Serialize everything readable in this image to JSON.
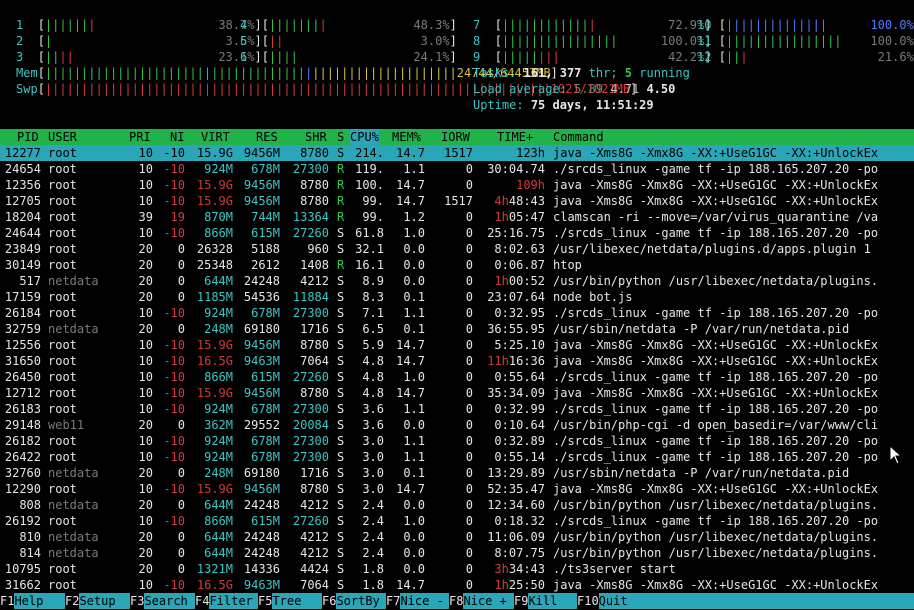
{
  "meters": {
    "cpus": [
      {
        "id": "1",
        "bar_green": "||||||",
        "bar_red": "|",
        "pct": "38.7%"
      },
      {
        "id": "2",
        "bar_green": "|",
        "bar_red": "",
        "pct": "3.6%"
      },
      {
        "id": "3",
        "bar_green": "||",
        "bar_red": "||",
        "pct": "23.1%"
      },
      {
        "id": "4",
        "bar_green": "|||||||",
        "bar_red": "|",
        "pct": "48.3%"
      },
      {
        "id": "5",
        "bar_green": "",
        "bar_red": "||",
        "pct": "3.0%"
      },
      {
        "id": "6",
        "bar_green": "||||",
        "bar_red": "",
        "pct": "24.1%"
      },
      {
        "id": "7",
        "bar_green": "||||||||||||",
        "bar_red": "|",
        "pct": "72.9%"
      },
      {
        "id": "8",
        "bar_green": "||||||||||||||||",
        "bar_red": "",
        "pct": "100.0%"
      },
      {
        "id": "9",
        "bar_green": "|||||",
        "bar_red": "|||",
        "pct": "42.2%"
      },
      {
        "id": "10",
        "bar_green": "",
        "bar_red": "",
        "pct": "100.0%",
        "bar_blue": "||||||||||||||"
      },
      {
        "id": "11",
        "bar_green": "||||||||||||||||",
        "bar_red": "",
        "pct": "100.0%"
      },
      {
        "id": "12",
        "bar_green": "||",
        "bar_red": "|",
        "pct": "21.6%"
      }
    ],
    "mem": {
      "label": "Mem",
      "value": "24744/64453MB"
    },
    "swp": {
      "label": "Swp",
      "value": "1021/1021MB"
    }
  },
  "summary": {
    "tasks_label": "Tasks:",
    "tasks_value": "161,",
    "threads_value": "377",
    "threads_label": "thr;",
    "running_value": "5",
    "running_label": "running",
    "load_label": "Load average:",
    "load_1": "5.89",
    "load_5": "4.71",
    "load_15": "4.50",
    "uptime_label": "Uptime:",
    "uptime_value": "75 days, 11:51:29"
  },
  "columns": [
    "PID",
    "USER",
    "PRI",
    "NI",
    "VIRT",
    "RES",
    "SHR",
    "S",
    "CPU%",
    "MEM%",
    "IORW",
    "TIME+",
    "Command"
  ],
  "processes": [
    {
      "pid": "12277",
      "user": "root",
      "pri": "10",
      "ni": "-10",
      "virt": "15.9G",
      "res": "9456M",
      "shr": "8780",
      "s": "S",
      "cpu": "214.",
      "mem": "14.7",
      "iorw": "1517",
      "time": "123h",
      "cmd": "java -Xms8G -Xmx8G -XX:+UseG1GC -XX:+UnlockEx"
    },
    {
      "pid": "24654",
      "user": "root",
      "pri": "10",
      "ni": "-10",
      "virt": "924M",
      "res": "678M",
      "shr": "27300",
      "s": "R",
      "cpu": "119.",
      "mem": "1.1",
      "iorw": "0",
      "time": "30:04.74",
      "cmd": "./srcds_linux -game tf -ip 188.165.207.20 -po"
    },
    {
      "pid": "12356",
      "user": "root",
      "pri": "10",
      "ni": "-10",
      "virt": "15.9G",
      "res": "9456M",
      "shr": "8780",
      "s": "R",
      "cpu": "100.",
      "mem": "14.7",
      "iorw": "0",
      "time": "109h",
      "cmd": "java -Xms8G -Xmx8G -XX:+UseG1GC -XX:+UnlockEx"
    },
    {
      "pid": "12705",
      "user": "root",
      "pri": "10",
      "ni": "-10",
      "virt": "15.9G",
      "res": "9456M",
      "shr": "8780",
      "s": "R",
      "cpu": "99.",
      "mem": "14.7",
      "iorw": "1517",
      "time": "4h48:43",
      "cmd": "java -Xms8G -Xmx8G -XX:+UseG1GC -XX:+UnlockEx"
    },
    {
      "pid": "18204",
      "user": "root",
      "pri": "39",
      "ni": "19",
      "virt": "870M",
      "res": "744M",
      "shr": "13364",
      "s": "R",
      "cpu": "99.",
      "mem": "1.2",
      "iorw": "0",
      "time": "1h05:47",
      "cmd": "clamscan -ri --move=/var/virus_quarantine /va"
    },
    {
      "pid": "24644",
      "user": "root",
      "pri": "10",
      "ni": "-10",
      "virt": "866M",
      "res": "615M",
      "shr": "27260",
      "s": "S",
      "cpu": "61.8",
      "mem": "1.0",
      "iorw": "0",
      "time": "25:16.75",
      "cmd": "./srcds_linux -game tf -ip 188.165.207.20 -po"
    },
    {
      "pid": "23849",
      "user": "root",
      "pri": "20",
      "ni": "0",
      "virt": "26328",
      "res": "5188",
      "shr": "960",
      "s": "S",
      "cpu": "32.1",
      "mem": "0.0",
      "iorw": "0",
      "time": "8:02.63",
      "cmd": "/usr/libexec/netdata/plugins.d/apps.plugin 1"
    },
    {
      "pid": "30149",
      "user": "root",
      "pri": "20",
      "ni": "0",
      "virt": "25348",
      "res": "2612",
      "shr": "1408",
      "s": "R",
      "cpu": "16.1",
      "mem": "0.0",
      "iorw": "0",
      "time": "0:06.87",
      "cmd": "htop"
    },
    {
      "pid": "517",
      "user": "netdata",
      "pri": "20",
      "ni": "0",
      "virt": "644M",
      "res": "24248",
      "shr": "4212",
      "s": "S",
      "cpu": "8.9",
      "mem": "0.0",
      "iorw": "0",
      "time": "1h00:52",
      "cmd": "/usr/bin/python /usr/libexec/netdata/plugins."
    },
    {
      "pid": "17159",
      "user": "root",
      "pri": "20",
      "ni": "0",
      "virt": "1185M",
      "res": "54536",
      "shr": "11884",
      "s": "S",
      "cpu": "8.3",
      "mem": "0.1",
      "iorw": "0",
      "time": "23:07.64",
      "cmd": "node bot.js"
    },
    {
      "pid": "26184",
      "user": "root",
      "pri": "10",
      "ni": "-10",
      "virt": "924M",
      "res": "678M",
      "shr": "27300",
      "s": "S",
      "cpu": "7.1",
      "mem": "1.1",
      "iorw": "0",
      "time": "0:32.95",
      "cmd": "./srcds_linux -game tf -ip 188.165.207.20 -po"
    },
    {
      "pid": "32759",
      "user": "netdata",
      "pri": "20",
      "ni": "0",
      "virt": "248M",
      "res": "69180",
      "shr": "1716",
      "s": "S",
      "cpu": "6.5",
      "mem": "0.1",
      "iorw": "0",
      "time": "36:55.95",
      "cmd": "/usr/sbin/netdata -P /var/run/netdata.pid"
    },
    {
      "pid": "12556",
      "user": "root",
      "pri": "10",
      "ni": "-10",
      "virt": "15.9G",
      "res": "9456M",
      "shr": "8780",
      "s": "S",
      "cpu": "5.9",
      "mem": "14.7",
      "iorw": "0",
      "time": "5:25.10",
      "cmd": "java -Xms8G -Xmx8G -XX:+UseG1GC -XX:+UnlockEx"
    },
    {
      "pid": "31650",
      "user": "root",
      "pri": "10",
      "ni": "-10",
      "virt": "16.5G",
      "res": "9463M",
      "shr": "7064",
      "s": "S",
      "cpu": "4.8",
      "mem": "14.7",
      "iorw": "0",
      "time": "11h16:36",
      "cmd": "java -Xms8G -Xmx8G -XX:+UseG1GC -XX:+UnlockEx"
    },
    {
      "pid": "26450",
      "user": "root",
      "pri": "10",
      "ni": "-10",
      "virt": "866M",
      "res": "615M",
      "shr": "27260",
      "s": "S",
      "cpu": "4.8",
      "mem": "1.0",
      "iorw": "0",
      "time": "0:55.64",
      "cmd": "./srcds_linux -game tf -ip 188.165.207.20 -po"
    },
    {
      "pid": "12712",
      "user": "root",
      "pri": "10",
      "ni": "-10",
      "virt": "15.9G",
      "res": "9456M",
      "shr": "8780",
      "s": "S",
      "cpu": "4.8",
      "mem": "14.7",
      "iorw": "0",
      "time": "35:34.09",
      "cmd": "java -Xms8G -Xmx8G -XX:+UseG1GC -XX:+UnlockEx"
    },
    {
      "pid": "26183",
      "user": "root",
      "pri": "10",
      "ni": "-10",
      "virt": "924M",
      "res": "678M",
      "shr": "27300",
      "s": "S",
      "cpu": "3.6",
      "mem": "1.1",
      "iorw": "0",
      "time": "0:32.99",
      "cmd": "./srcds_linux -game tf -ip 188.165.207.20 -po"
    },
    {
      "pid": "29148",
      "user": "web11",
      "pri": "20",
      "ni": "0",
      "virt": "362M",
      "res": "29552",
      "shr": "20084",
      "s": "S",
      "cpu": "3.6",
      "mem": "0.0",
      "iorw": "0",
      "time": "0:10.64",
      "cmd": "/usr/bin/php-cgi -d open_basedir=/var/www/cli"
    },
    {
      "pid": "26182",
      "user": "root",
      "pri": "10",
      "ni": "-10",
      "virt": "924M",
      "res": "678M",
      "shr": "27300",
      "s": "S",
      "cpu": "3.0",
      "mem": "1.1",
      "iorw": "0",
      "time": "0:32.89",
      "cmd": "./srcds_linux -game tf -ip 188.165.207.20 -po"
    },
    {
      "pid": "26422",
      "user": "root",
      "pri": "10",
      "ni": "-10",
      "virt": "924M",
      "res": "678M",
      "shr": "27300",
      "s": "S",
      "cpu": "3.0",
      "mem": "1.1",
      "iorw": "0",
      "time": "0:55.14",
      "cmd": "./srcds_linux -game tf -ip 188.165.207.20 -po"
    },
    {
      "pid": "32760",
      "user": "netdata",
      "pri": "20",
      "ni": "0",
      "virt": "248M",
      "res": "69180",
      "shr": "1716",
      "s": "S",
      "cpu": "3.0",
      "mem": "0.1",
      "iorw": "0",
      "time": "13:29.89",
      "cmd": "/usr/sbin/netdata -P /var/run/netdata.pid"
    },
    {
      "pid": "12290",
      "user": "root",
      "pri": "10",
      "ni": "-10",
      "virt": "15.9G",
      "res": "9456M",
      "shr": "8780",
      "s": "S",
      "cpu": "3.0",
      "mem": "14.7",
      "iorw": "0",
      "time": "52:35.47",
      "cmd": "java -Xms8G -Xmx8G -XX:+UseG1GC -XX:+UnlockEx"
    },
    {
      "pid": "808",
      "user": "netdata",
      "pri": "20",
      "ni": "0",
      "virt": "644M",
      "res": "24248",
      "shr": "4212",
      "s": "S",
      "cpu": "2.4",
      "mem": "0.0",
      "iorw": "0",
      "time": "12:34.60",
      "cmd": "/usr/bin/python /usr/libexec/netdata/plugins."
    },
    {
      "pid": "26192",
      "user": "root",
      "pri": "10",
      "ni": "-10",
      "virt": "866M",
      "res": "615M",
      "shr": "27260",
      "s": "S",
      "cpu": "2.4",
      "mem": "1.0",
      "iorw": "0",
      "time": "0:18.32",
      "cmd": "./srcds_linux -game tf -ip 188.165.207.20 -po"
    },
    {
      "pid": "810",
      "user": "netdata",
      "pri": "20",
      "ni": "0",
      "virt": "644M",
      "res": "24248",
      "shr": "4212",
      "s": "S",
      "cpu": "2.4",
      "mem": "0.0",
      "iorw": "0",
      "time": "11:06.09",
      "cmd": "/usr/bin/python /usr/libexec/netdata/plugins."
    },
    {
      "pid": "814",
      "user": "netdata",
      "pri": "20",
      "ni": "0",
      "virt": "644M",
      "res": "24248",
      "shr": "4212",
      "s": "S",
      "cpu": "2.4",
      "mem": "0.0",
      "iorw": "0",
      "time": "8:07.75",
      "cmd": "/usr/bin/python /usr/libexec/netdata/plugins."
    },
    {
      "pid": "10795",
      "user": "root",
      "pri": "20",
      "ni": "0",
      "virt": "1321M",
      "res": "14336",
      "shr": "4424",
      "s": "S",
      "cpu": "1.8",
      "mem": "0.0",
      "iorw": "0",
      "time": "3h34:43",
      "cmd": "./ts3server start"
    },
    {
      "pid": "31662",
      "user": "root",
      "pri": "10",
      "ni": "-10",
      "virt": "16.5G",
      "res": "9463M",
      "shr": "7064",
      "s": "S",
      "cpu": "1.8",
      "mem": "14.7",
      "iorw": "0",
      "time": "1h25:50",
      "cmd": "java -Xms8G -Xmx8G -XX:+UseG1GC -XX:+UnlockEx"
    }
  ],
  "fkeys": [
    {
      "key": "F1",
      "label": "Help"
    },
    {
      "key": "F2",
      "label": "Setup"
    },
    {
      "key": "F3",
      "label": "Search"
    },
    {
      "key": "F4",
      "label": "Filter"
    },
    {
      "key": "F5",
      "label": "Tree"
    },
    {
      "key": "F6",
      "label": "SortBy"
    },
    {
      "key": "F7",
      "label": "Nice -"
    },
    {
      "key": "F8",
      "label": "Nice +"
    },
    {
      "key": "F9",
      "label": "Kill"
    },
    {
      "key": "F10",
      "label": "Quit"
    }
  ],
  "colors": {
    "header_bg": "#22b24a",
    "selected_bg": "#2aa6b8",
    "green": "#2ec44a",
    "red": "#d23a3a",
    "cyan": "#3ac6c6",
    "blue": "#4f7cff"
  }
}
